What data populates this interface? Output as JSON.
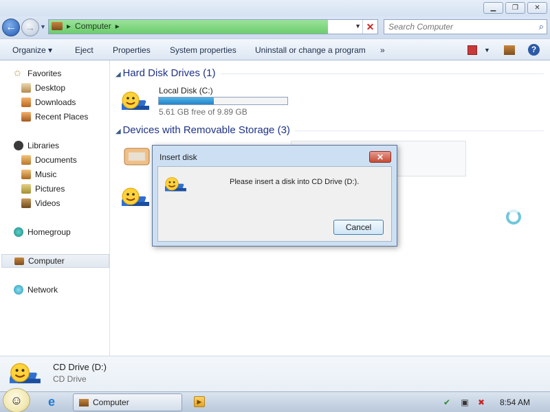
{
  "window": {
    "minimize_glyph": "▁",
    "maximize_glyph": "❐",
    "close_glyph": "✕"
  },
  "address": {
    "path": "Computer",
    "separator": "▸",
    "search_placeholder": "Search Computer",
    "load_progress": 0.85
  },
  "toolbar": {
    "organize": "Organize ▾",
    "eject": "Eject",
    "properties": "Properties",
    "system_properties": "System properties",
    "uninstall": "Uninstall or change a program",
    "more": "»"
  },
  "sidebar": {
    "favorites": "Favorites",
    "desktop": "Desktop",
    "downloads": "Downloads",
    "recent_places": "Recent Places",
    "libraries": "Libraries",
    "documents": "Documents",
    "music": "Music",
    "pictures": "Pictures",
    "videos": "Videos",
    "homegroup": "Homegroup",
    "computer": "Computer",
    "network": "Network"
  },
  "content": {
    "hard_disk_group": "Hard Disk Drives (1)",
    "local_disk_name": "Local Disk (C:)",
    "local_disk_free": "5.61 GB free of 9.89 GB",
    "local_disk_used_fraction": 0.43,
    "removable_group": "Devices with Removable Storage (3)"
  },
  "details": {
    "name": "CD Drive (D:)",
    "type": "CD Drive"
  },
  "dialog": {
    "title": "Insert disk",
    "message": "Please insert a disk into CD Drive (D:).",
    "cancel": "Cancel"
  },
  "taskbar": {
    "task_label": "Computer",
    "clock": "8:54 AM"
  },
  "colors": {
    "group_title": "#1e3287",
    "progress_green": "#6ccd6c",
    "disk_bar": "#2683c7"
  }
}
